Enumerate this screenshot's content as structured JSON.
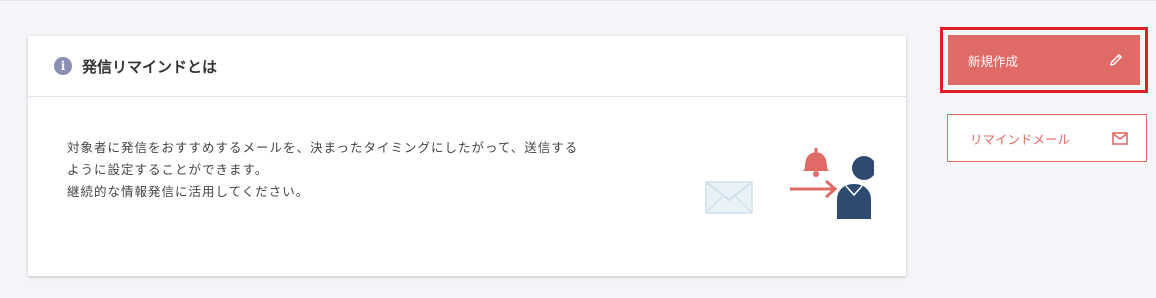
{
  "card": {
    "title": "発信リマインドとは",
    "info_icon": "i",
    "description_lines": [
      "対象者に発信をおすすめするメールを、決まったタイミングにしたがって、送信する",
      "ように設定することができます。",
      "継続的な情報発信に活用してください。"
    ]
  },
  "actions": {
    "create_label": "新規作成",
    "remind_mail_label": "リマインドメール"
  },
  "colors": {
    "accent": "#e06a66",
    "highlight_border": "#e01e25",
    "person": "#2d4a6f",
    "envelope": "#d3e4ee",
    "info_icon": "#8a8fb3"
  }
}
